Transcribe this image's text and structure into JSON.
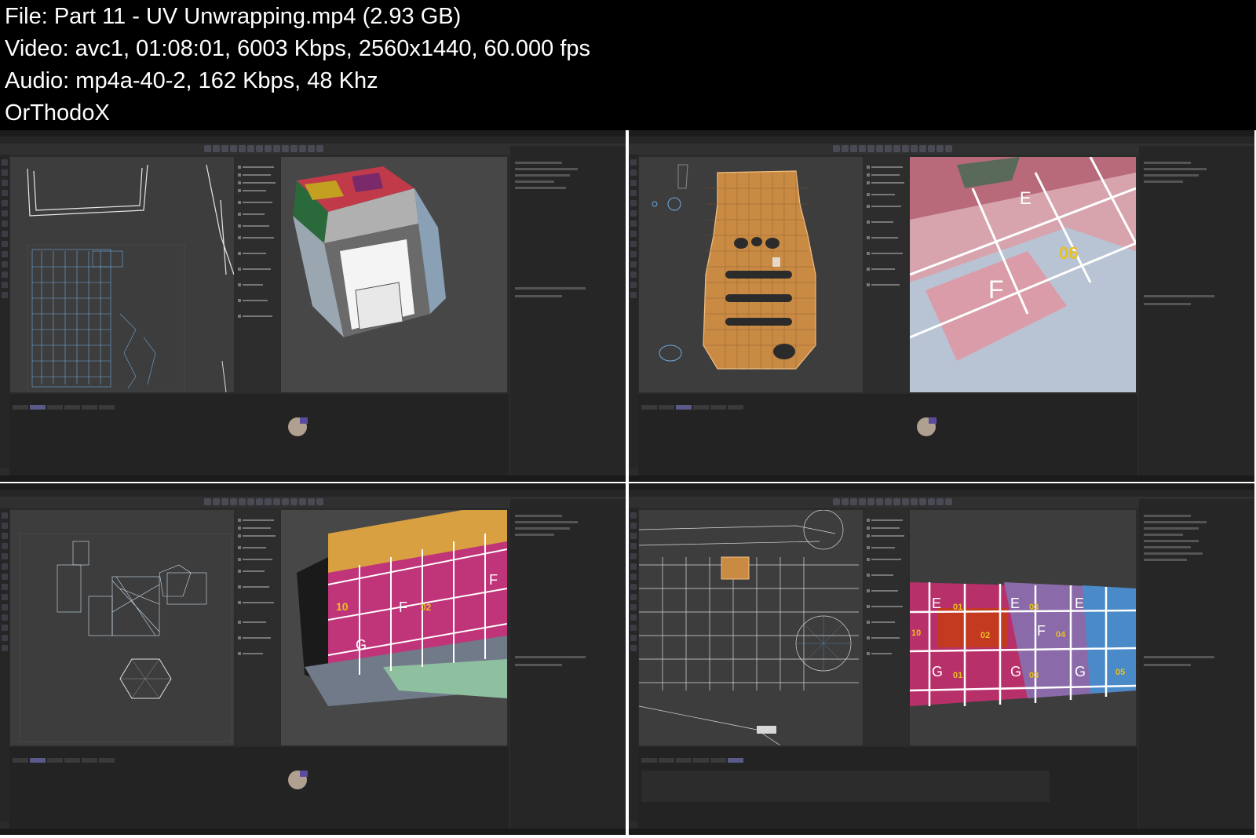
{
  "header": {
    "lines": [
      "File: Part 11 - UV Unwrapping.mp4 (2.93 GB)",
      "Video: avc1, 01:08:01, 6003 Kbps, 2560x1440, 60.000 fps",
      "Audio: mp4a-40-2, 162 Kbps, 48 Khz",
      "OrThodoX"
    ]
  },
  "thumbnails": [
    {
      "name": "thumb-1"
    },
    {
      "name": "thumb-2"
    },
    {
      "name": "thumb-3"
    },
    {
      "name": "thumb-4"
    }
  ],
  "viewport_labels": {
    "t2_letter_e": "E",
    "t2_num_06": "06",
    "t2_letter_f": "F",
    "t3_num_10": "10",
    "t3_letter_f": "F",
    "t3_num_02": "02",
    "t3_letter_g": "G",
    "t3_letter_f2": "F",
    "t4_letter_e1": "E",
    "t4_num_01": "01",
    "t4_letter_e2": "E",
    "t4_num_03": "03",
    "t4_letter_e3": "E",
    "t4_num_10": "10",
    "t4_num_02": "02",
    "t4_letter_f": "F",
    "t4_num_04": "04",
    "t4_letter_g1": "G",
    "t4_num_01b": "01",
    "t4_letter_g2": "G",
    "t4_num_03b": "03",
    "t4_letter_g3": "G",
    "t4_num_05": "05"
  }
}
